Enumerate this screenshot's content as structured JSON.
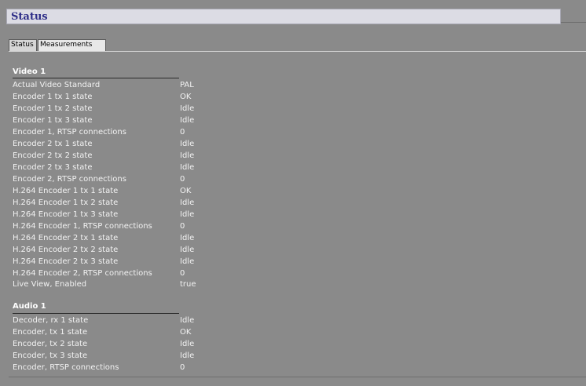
{
  "page": {
    "title": "Status"
  },
  "tabs": [
    {
      "label": "Status",
      "active": true
    },
    {
      "label": "Measurements",
      "active": false
    }
  ],
  "sections": [
    {
      "title": "Video 1",
      "rows": [
        {
          "label": "Actual Video Standard",
          "value": "PAL"
        },
        {
          "label": "Encoder 1 tx 1 state",
          "value": "OK"
        },
        {
          "label": "Encoder 1 tx 2 state",
          "value": "Idle"
        },
        {
          "label": "Encoder 1 tx 3 state",
          "value": "Idle"
        },
        {
          "label": "Encoder 1, RTSP connections",
          "value": "0"
        },
        {
          "label": "Encoder 2 tx 1 state",
          "value": "Idle"
        },
        {
          "label": "Encoder 2 tx 2 state",
          "value": "Idle"
        },
        {
          "label": "Encoder 2 tx 3 state",
          "value": "Idle"
        },
        {
          "label": "Encoder 2, RTSP connections",
          "value": "0"
        },
        {
          "label": "H.264 Encoder 1 tx 1 state",
          "value": "OK"
        },
        {
          "label": "H.264 Encoder 1 tx 2 state",
          "value": "Idle"
        },
        {
          "label": "H.264 Encoder 1 tx 3 state",
          "value": "Idle"
        },
        {
          "label": "H.264 Encoder 1, RTSP connections",
          "value": "0"
        },
        {
          "label": "H.264 Encoder 2 tx 1 state",
          "value": "Idle"
        },
        {
          "label": "H.264 Encoder 2 tx 2 state",
          "value": "Idle"
        },
        {
          "label": "H.264 Encoder 2 tx 3 state",
          "value": "Idle"
        },
        {
          "label": "H.264 Encoder 2, RTSP connections",
          "value": "0"
        },
        {
          "label": "Live View, Enabled",
          "value": "true"
        }
      ]
    },
    {
      "title": "Audio 1",
      "rows": [
        {
          "label": "Decoder, rx 1 state",
          "value": "Idle"
        },
        {
          "label": "Encoder, tx 1 state",
          "value": "OK"
        },
        {
          "label": "Encoder, tx 2 state",
          "value": "Idle"
        },
        {
          "label": "Encoder, tx 3 state",
          "value": "Idle"
        },
        {
          "label": "Encoder, RTSP connections",
          "value": "0"
        }
      ]
    }
  ]
}
